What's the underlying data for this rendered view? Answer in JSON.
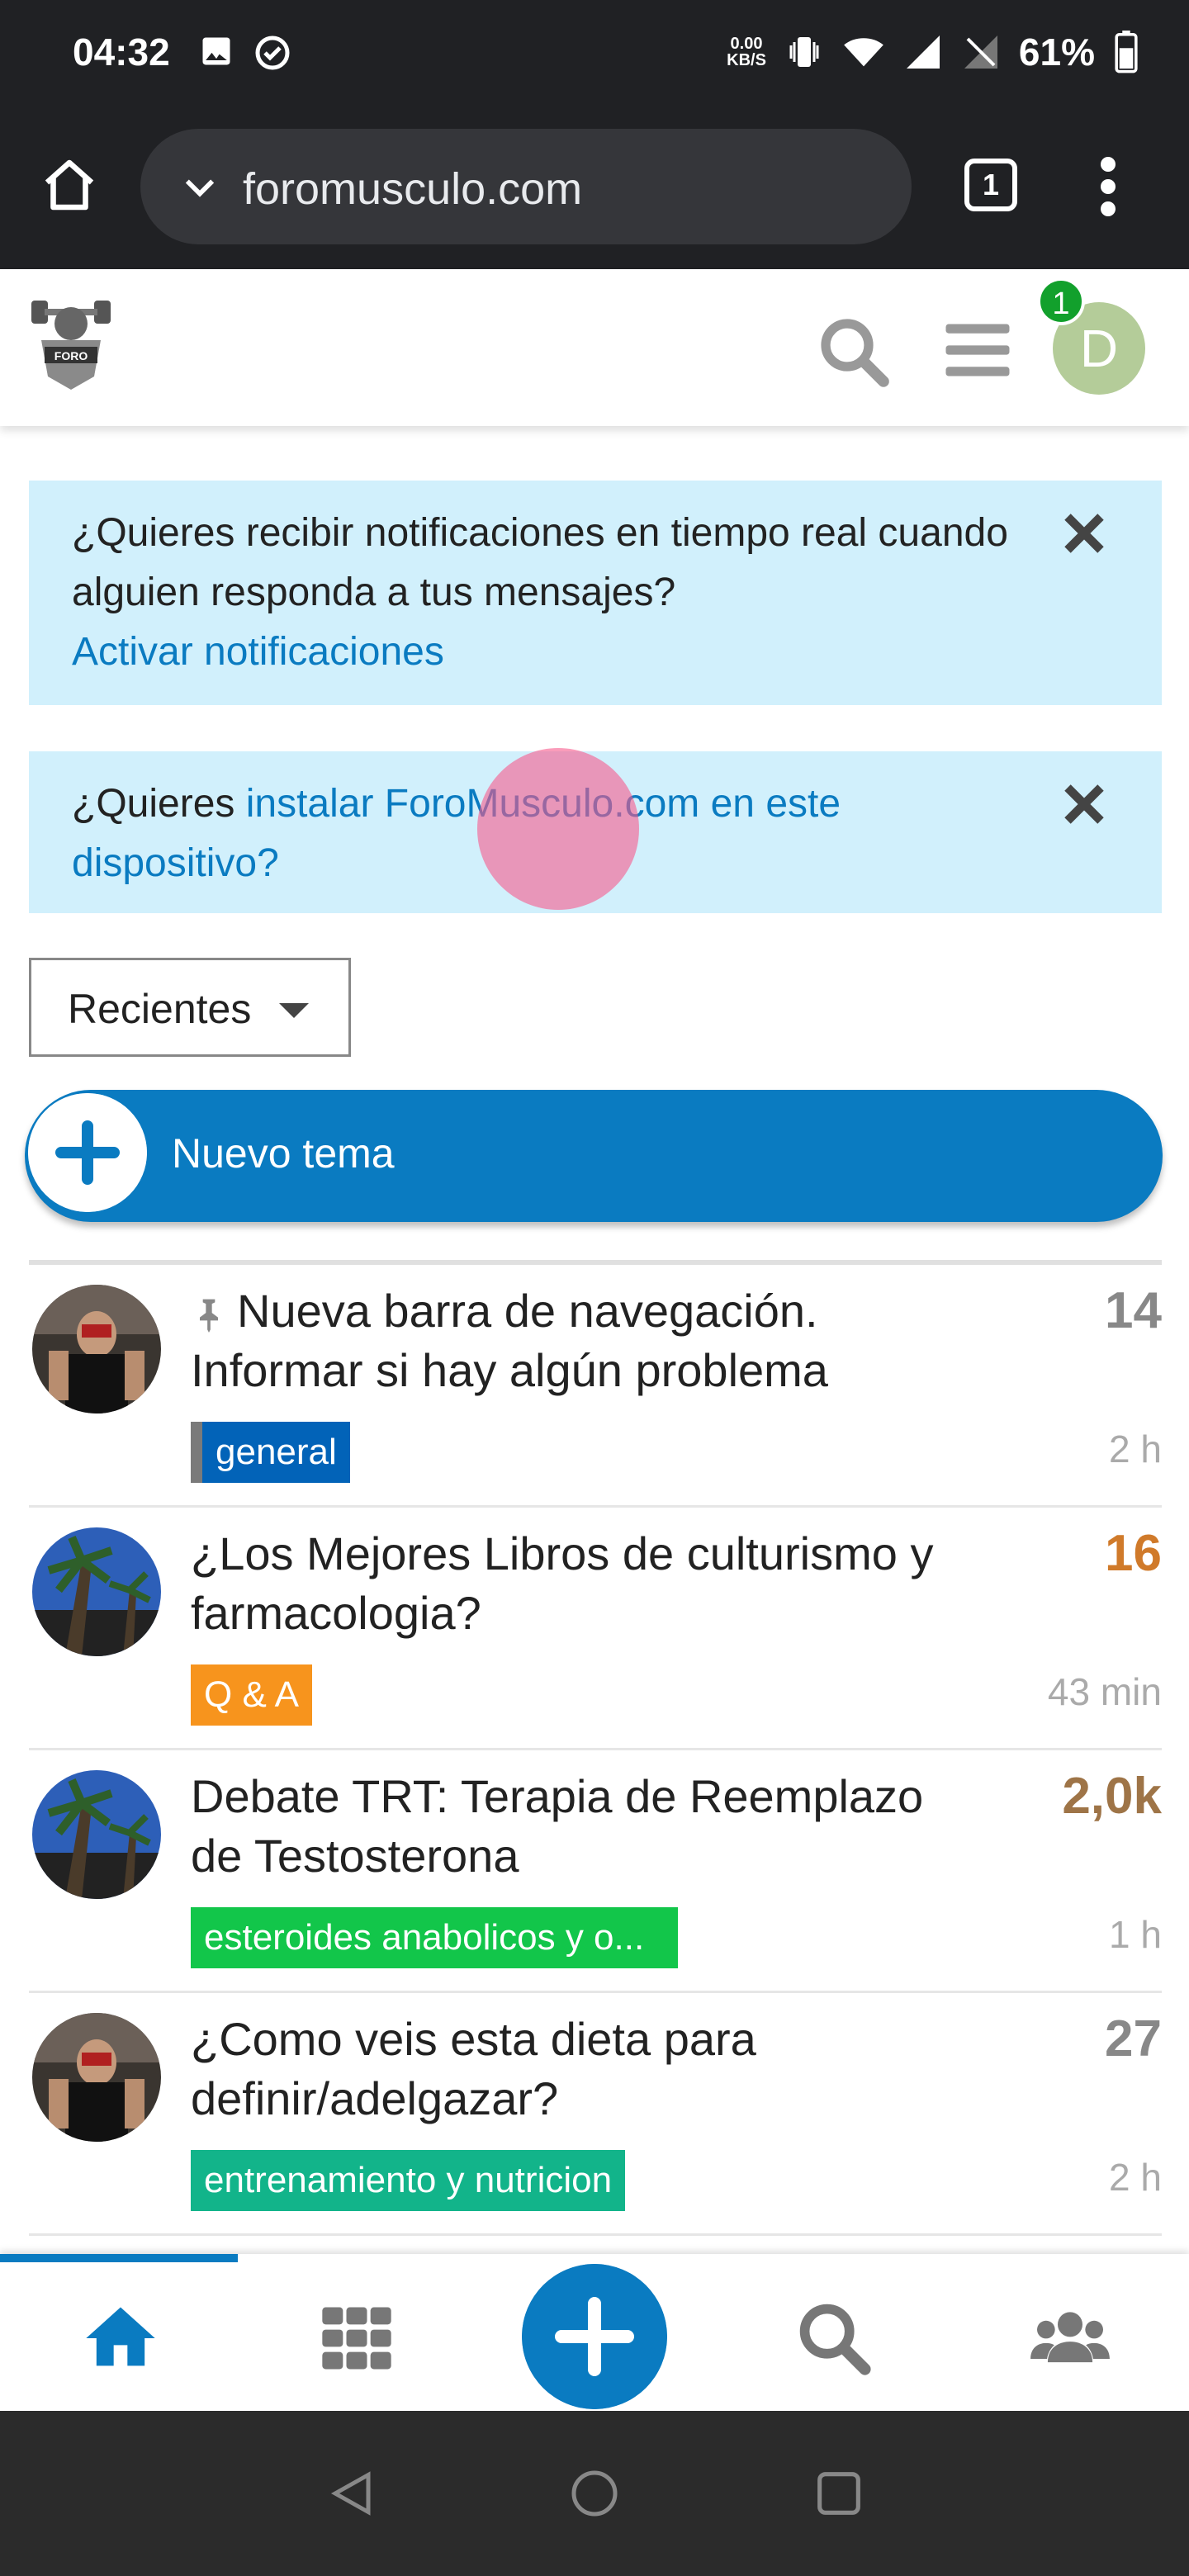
{
  "status_bar": {
    "time": "04:32",
    "net_speed": "0.00",
    "net_unit": "KB/S",
    "battery": "61%"
  },
  "browser": {
    "url": "foromusculo.com",
    "tab_count": "1"
  },
  "header": {
    "avatar_letter": "D",
    "notification_count": "1"
  },
  "banners": {
    "notifications": {
      "text": "¿Quieres recibir notificaciones en tiempo real cuando alguien responda a tus mensajes?",
      "link": "Activar notificaciones"
    },
    "install": {
      "prefix": "¿Quieres ",
      "link": "instalar ForoMusculo.com en este dispositivo?"
    }
  },
  "filter": {
    "label": "Recientes"
  },
  "new_topic": {
    "label": "Nuevo tema"
  },
  "topics": [
    {
      "title": "Nueva barra de navegación. Informar si hay algún problema",
      "category": "general",
      "count": "14",
      "time": "2 h",
      "pinned": true
    },
    {
      "title": "¿Los Mejores Libros de culturismo y farmacologia?",
      "category": "Q & A",
      "count": "16",
      "time": "43 min",
      "pinned": false
    },
    {
      "title": "Debate TRT: Terapia de Reemplazo de Testosterona",
      "category": "esteroides anabolicos y o...",
      "count": "2,0k",
      "time": "1 h",
      "pinned": false
    },
    {
      "title": "¿Como veis esta dieta para definir/adelgazar?",
      "category": "entrenamiento y nutricion",
      "count": "27",
      "time": "2 h",
      "pinned": false
    }
  ],
  "colors": {
    "accent": "#0a7bc1",
    "banner_bg": "#d1f0fc",
    "count_hot": "#d07a2a",
    "count_very_hot": "#9e7447"
  }
}
